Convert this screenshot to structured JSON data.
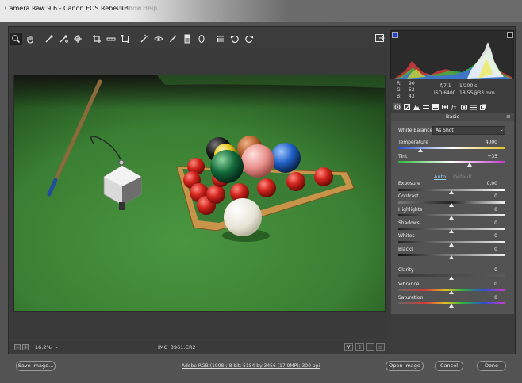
{
  "window": {
    "title": "Camera Raw 9.6  -  Canon EOS Rebel T3i",
    "ghost_menus": [
      "Window",
      "Help"
    ]
  },
  "toolbar": {
    "tools": [
      "zoom-tool",
      "hand-tool",
      "white-balance-tool",
      "color-sampler-tool",
      "targeted-adjustment-tool",
      "crop-tool",
      "straighten-tool",
      "transform-tool",
      "spot-removal-tool",
      "red-eye-tool",
      "adjustment-brush-tool",
      "graduated-filter-tool",
      "radial-filter-tool",
      "preferences",
      "rotate-left",
      "rotate-right"
    ],
    "active_tool": "zoom-tool"
  },
  "preview": {
    "zoom": "16.2%",
    "filename": "IMG_3961.CR2",
    "view_buttons": [
      "Y",
      "↕",
      "+",
      "≡"
    ]
  },
  "readout": {
    "r_label": "R:",
    "r_value": "90",
    "g_label": "G:",
    "g_value": "52",
    "b_label": "B:",
    "b_value": "43",
    "aperture": "f/7.1",
    "shutter": "1/200 s",
    "iso": "ISO 6400",
    "lens": "18-55@33 mm"
  },
  "panel": {
    "title": "Basic",
    "white_balance_label": "White Balance:",
    "white_balance_value": "As Shot",
    "auto_label": "Auto",
    "default_label": "Default",
    "sliders": [
      {
        "id": "temperature",
        "label": "Temperature",
        "value": "4000",
        "position": 0.2
      },
      {
        "id": "tint",
        "label": "Tint",
        "value": "+35",
        "position": 0.68
      },
      {
        "id": "exposure",
        "label": "Exposure",
        "value": "0,00",
        "position": 0.5
      },
      {
        "id": "contrast",
        "label": "Contrast",
        "value": "0",
        "position": 0.5
      },
      {
        "id": "highlights",
        "label": "Highlights",
        "value": "0",
        "position": 0.5
      },
      {
        "id": "shadows",
        "label": "Shadows",
        "value": "0",
        "position": 0.5
      },
      {
        "id": "whites",
        "label": "Whites",
        "value": "0",
        "position": 0.5
      },
      {
        "id": "blacks",
        "label": "Blacks",
        "value": "0",
        "position": 0.5
      },
      {
        "id": "clarity",
        "label": "Clarity",
        "value": "0",
        "position": 0.5
      },
      {
        "id": "vibrance",
        "label": "Vibrance",
        "value": "0",
        "position": 0.5
      },
      {
        "id": "saturation",
        "label": "Saturation",
        "value": "0",
        "position": 0.5
      }
    ]
  },
  "footer": {
    "save_label": "Save Image...",
    "workflow_text": "Adobe RGB (1998); 8 bit; 5184 by 3456 (17,9MP); 300 ppi",
    "open_label": "Open Image",
    "cancel_label": "Cancel",
    "done_label": "Done"
  },
  "colors": {
    "accent_blue": "#1f3bd6",
    "felt_green": "#3f8a3a",
    "link_blue": "#9ecbff"
  }
}
